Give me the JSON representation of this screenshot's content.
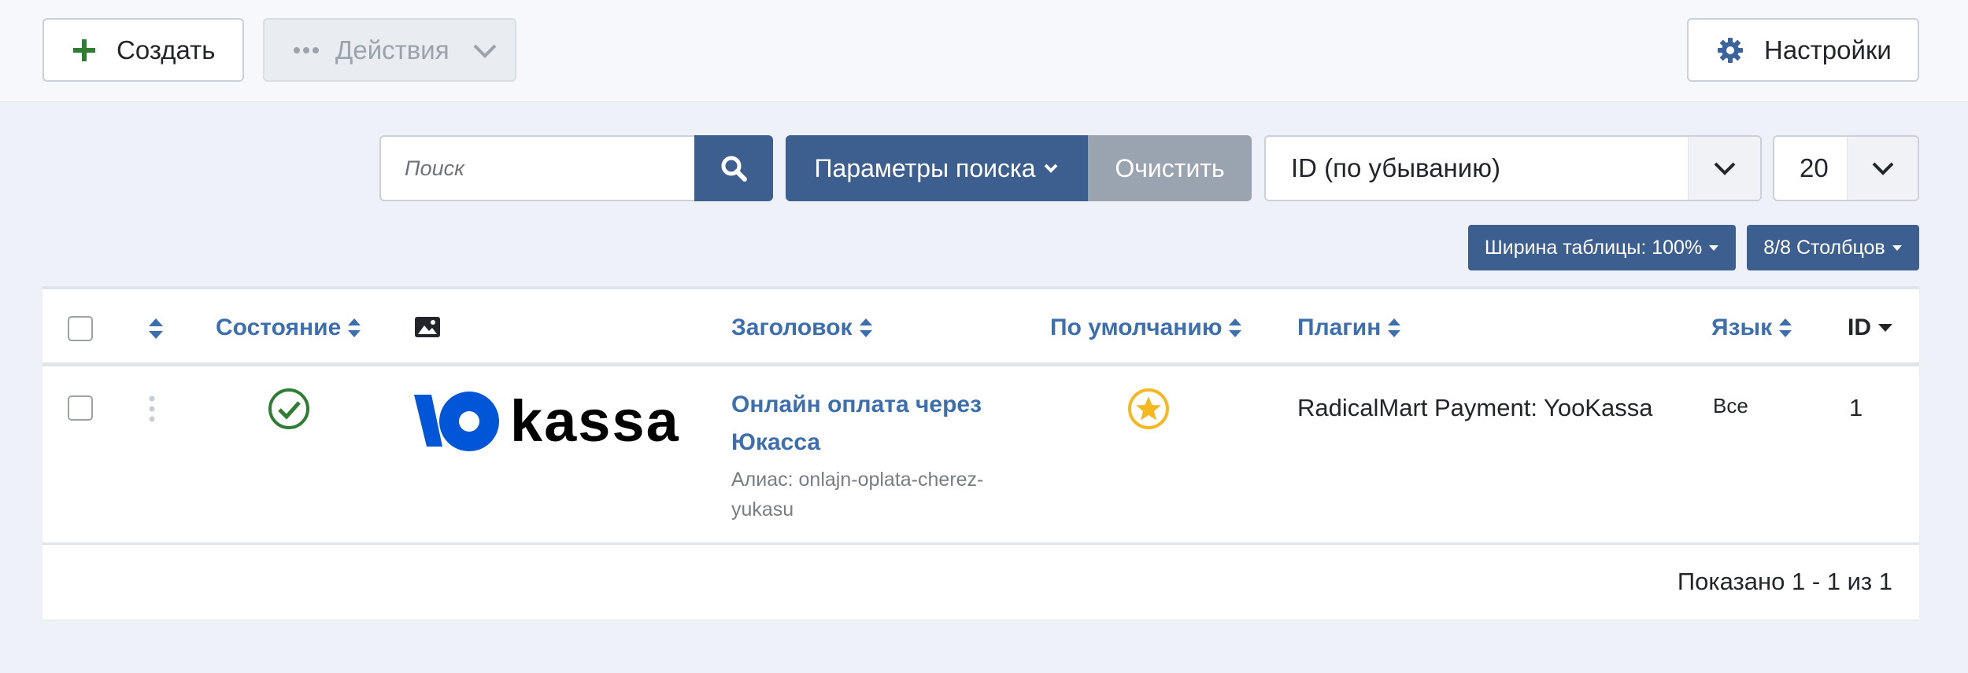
{
  "toolbar": {
    "create_label": "Создать",
    "actions_label": "Действия",
    "settings_label": "Настройки"
  },
  "filters": {
    "search_placeholder": "Поиск",
    "params_label": "Параметры поиска",
    "clear_label": "Очистить",
    "order_value": "ID (по убыванию)",
    "limit_value": "20",
    "table_width_label": "Ширина таблицы: 100%",
    "columns_label": "8/8 Столбцов"
  },
  "table": {
    "headers": {
      "state": "Состояние",
      "title": "Заголовок",
      "default": "По умолчанию",
      "plugin": "Плагин",
      "language": "Язык",
      "id": "ID"
    },
    "rows": [
      {
        "image_logo_text": "kassa",
        "title_line1": "Онлайн оплата через",
        "title_line2": "Юкасса",
        "alias_line1": "Алиас: onlajn-oplata-cherez-",
        "alias_line2": "yukasu",
        "plugin": "RadicalMart Payment: YooKassa",
        "language": "Все",
        "id": "1",
        "state": "published",
        "is_default": true
      }
    ],
    "footer": "Показано 1 - 1 из 1"
  },
  "colors": {
    "primary": "#3d5f8f",
    "link": "#3d6fae",
    "success": "#2f7d32",
    "star": "#f5b820",
    "clear": "#99a4b0"
  },
  "icons": {
    "create": "plus-icon",
    "actions": "ellipsis-icon",
    "settings": "gear-icon",
    "search": "search-icon",
    "state": "check-circle-icon",
    "default": "star-icon",
    "image_column": "image-icon"
  }
}
